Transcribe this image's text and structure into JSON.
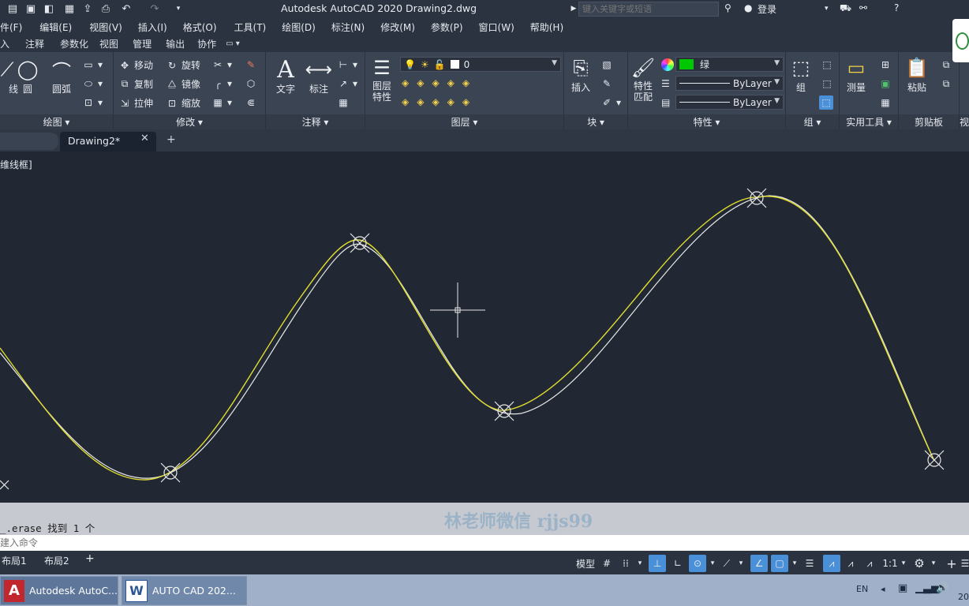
{
  "window": {
    "title": "Autodesk AutoCAD 2020    Drawing2.dwg",
    "search_placeholder": "键入关键字或短语",
    "login_label": "登录"
  },
  "menubar": {
    "items": [
      "件(F)",
      "编辑(E)",
      "视图(V)",
      "插入(I)",
      "格式(O)",
      "工具(T)",
      "绘图(D)",
      "标注(N)",
      "修改(M)",
      "参数(P)",
      "窗口(W)",
      "帮助(H)"
    ]
  },
  "ribbon_tabs": [
    "入",
    "注释",
    "参数化",
    "视图",
    "管理",
    "输出",
    "协作"
  ],
  "ribbon": {
    "draw": {
      "footer": "绘图",
      "line": "线",
      "circle": "圆",
      "arc": "圆弧"
    },
    "modify": {
      "footer": "修改",
      "move": "移动",
      "rotate": "旋转",
      "copy": "复制",
      "mirror": "镜像",
      "stretch": "拉伸",
      "scale": "缩放"
    },
    "annotation": {
      "footer": "注释",
      "text": "文字",
      "dimension": "标注"
    },
    "layers": {
      "footer": "图层",
      "layer_props": "图层特性",
      "current_layer": "0"
    },
    "block": {
      "footer": "块",
      "insert": "插入"
    },
    "properties": {
      "footer": "特性",
      "match": "特性匹配",
      "color": "绿",
      "color_hex": "#00c800",
      "linetype": "ByLayer",
      "lineweight": "ByLayer"
    },
    "group": {
      "footer": "组",
      "group": "组"
    },
    "utilities": {
      "footer": "实用工具",
      "measure": "测量"
    },
    "clipboard": {
      "footer": "剪贴板",
      "paste": "粘贴"
    }
  },
  "file_tabs": {
    "active": "Drawing2*"
  },
  "viewport": {
    "label": "维线框]"
  },
  "watermark": "林老师微信 rjjs99",
  "command": {
    "history": "_.erase 找到 1 个",
    "input_placeholder": "建入命令"
  },
  "layout_tabs": [
    "布局1",
    "布局2"
  ],
  "statusbar": {
    "model": "模型",
    "scale": "1:1"
  },
  "taskbar": {
    "items": [
      "Autodesk AutoC...",
      "AUTO  CAD 202..."
    ],
    "lang": "EN",
    "clock": "20"
  },
  "colors": {
    "canvas": "#212833",
    "spline_yellow": "#e0dc30",
    "spline_white": "#e8e8e8",
    "ribbon": "#3b4453"
  }
}
